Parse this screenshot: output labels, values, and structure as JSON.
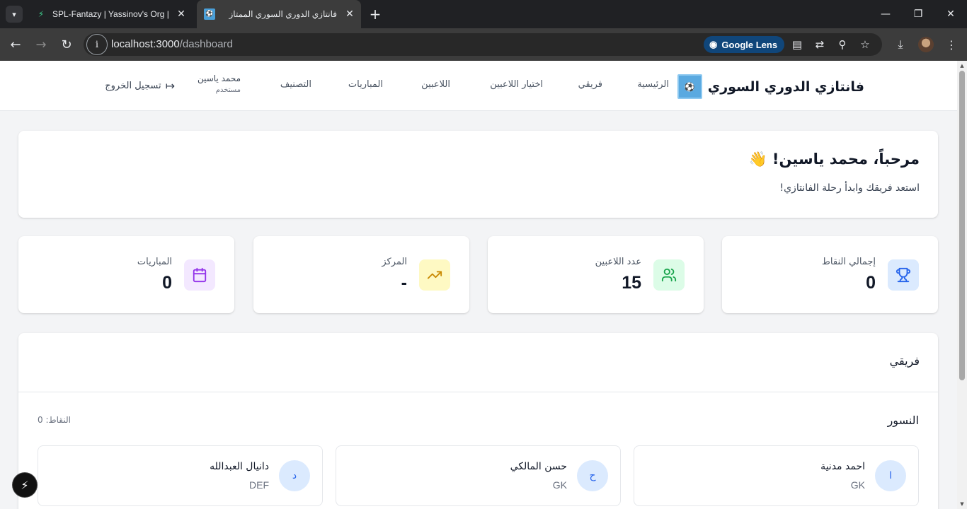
{
  "browser": {
    "tabs": [
      {
        "title": "SPL-Fantazy | Yassinov's Org | Su",
        "icon": "supabase-icon"
      },
      {
        "title": "فانتازي الدوري السوري الممتاز",
        "icon": "site-logo-icon"
      }
    ],
    "url_host": "localhost:3000",
    "url_path": "/dashboard",
    "lens_label": "Google Lens"
  },
  "navbar": {
    "brand": "فانتازي الدوري السوري",
    "links": [
      "الرئيسية",
      "فريقي",
      "اختيار اللاعبين",
      "اللاعبين",
      "المباريات",
      "التصنيف"
    ],
    "user_name": "محمد ياسين",
    "user_role": "مستخدم",
    "logout": "تسجيل الخروج"
  },
  "welcome": {
    "title": "مرحباً، محمد ياسين! 👋",
    "subtitle": "استعد فريقك وابدأ رحلة الفانتازي!"
  },
  "stats": [
    {
      "label": "إجمالي النقاط",
      "value": "0",
      "icon": "trophy-icon",
      "color": "#2563eb",
      "bg": "#dbeafe"
    },
    {
      "label": "عدد اللاعبين",
      "value": "15",
      "icon": "users-icon",
      "color": "#16a34a",
      "bg": "#dcfce7"
    },
    {
      "label": "المركز",
      "value": "-",
      "icon": "trending-up-icon",
      "color": "#ca8a04",
      "bg": "#fef9c3"
    },
    {
      "label": "المباريات",
      "value": "0",
      "icon": "calendar-icon",
      "color": "#9333ea",
      "bg": "#f3e8ff"
    }
  ],
  "team": {
    "heading": "فريقي",
    "name": "النسور",
    "points": "النقاط: 0",
    "players": [
      {
        "initial": "ا",
        "name": "احمد مدنية",
        "position": "GK"
      },
      {
        "initial": "ح",
        "name": "حسن المالكي",
        "position": "GK"
      },
      {
        "initial": "د",
        "name": "دانيال العبدالله",
        "position": "DEF"
      }
    ]
  }
}
